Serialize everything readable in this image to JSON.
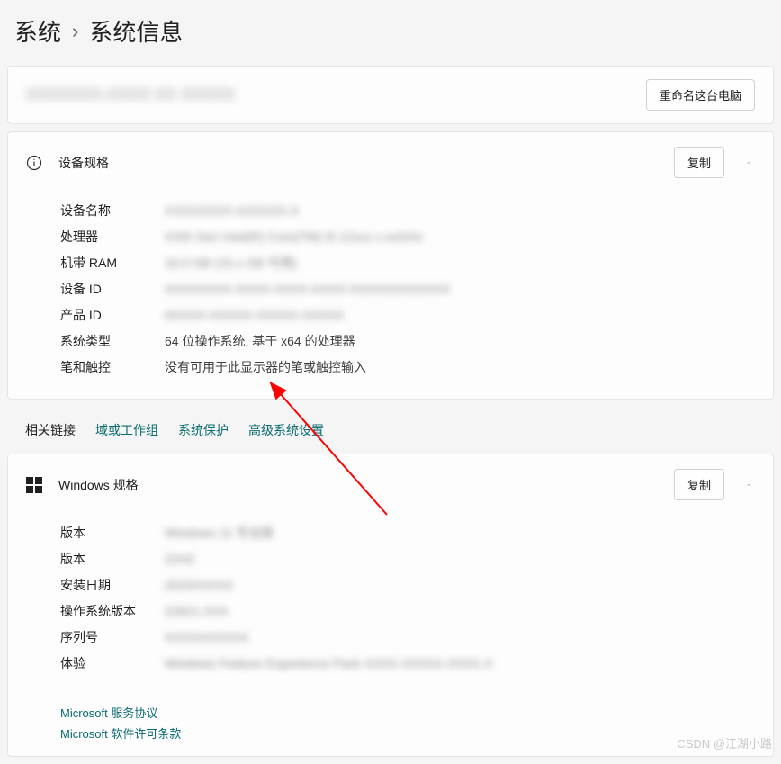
{
  "breadcrumb": {
    "parent": "系统",
    "separator": "›",
    "current": "系统信息"
  },
  "header": {
    "device_name_blur": "XXXXXXX-XXXX\nXX XXXXX",
    "rename_button": "重命名这台电脑"
  },
  "device_specs": {
    "title": "设备规格",
    "copy_button": "复制",
    "rows": [
      {
        "label": "设备名称",
        "value": "XXXXXXXX-XXXXXX-X",
        "blurred": true
      },
      {
        "label": "处理器",
        "value": "XXth Gen Intel(R) Core(TM) i5-12xxx   x.xxGHz",
        "blurred": true
      },
      {
        "label": "机带 RAM",
        "value": "16.0 GB (15.x GB 可用)",
        "blurred": true
      },
      {
        "label": "设备 ID",
        "value": "AXXXXXXX-XXXX-XXXX-XXXX-XXXXXXXXXXXX",
        "blurred": true
      },
      {
        "label": "产品 ID",
        "value": "0XXXX-XXXXX-XXXXX-XXXXX",
        "blurred": true
      },
      {
        "label": "系统类型",
        "value": "64 位操作系统, 基于 x64 的处理器",
        "blurred": false
      },
      {
        "label": "笔和触控",
        "value": "没有可用于此显示器的笔或触控输入",
        "blurred": false
      }
    ]
  },
  "related_links": {
    "label": "相关链接",
    "links": [
      "域或工作组",
      "系统保护",
      "高级系统设置"
    ]
  },
  "windows_specs": {
    "title": "Windows 规格",
    "copy_button": "复制",
    "rows": [
      {
        "label": "版本",
        "value": "Windows 11 专业版",
        "blurred": true
      },
      {
        "label": "版本",
        "value": "22H2",
        "blurred": true
      },
      {
        "label": "安装日期",
        "value": "2023/XX/XX",
        "blurred": true
      },
      {
        "label": "操作系统版本",
        "value": "22621.XXX",
        "blurred": true
      },
      {
        "label": "序列号",
        "value": "XXXXXXXXXX",
        "blurred": true
      },
      {
        "label": "体验",
        "value": "Windows Feature Experience Pack XXXX.XXXXX.XXXX.X",
        "blurred": true
      }
    ],
    "service_links": [
      "Microsoft 服务协议",
      "Microsoft 软件许可条款"
    ]
  },
  "watermark": "CSDN @江湖小路"
}
